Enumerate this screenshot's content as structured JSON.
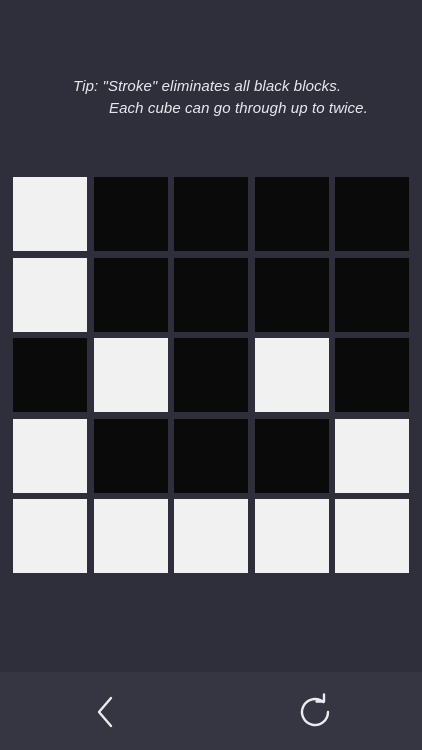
{
  "tip": {
    "line1": "Tip: \"Stroke\" eliminates all black blocks.",
    "line2": "Each cube can go through up to twice."
  },
  "board": {
    "rows": [
      [
        "white",
        "black",
        "black",
        "black",
        "black"
      ],
      [
        "white",
        "black",
        "black",
        "black",
        "black"
      ],
      [
        "black",
        "white",
        "black",
        "white",
        "black"
      ],
      [
        "white",
        "black",
        "black",
        "black",
        "white"
      ],
      [
        "white",
        "white",
        "white",
        "white",
        "white"
      ]
    ]
  },
  "nav": {
    "back_icon": "chevron-left-icon",
    "reload_icon": "reload-icon"
  },
  "colors": {
    "background": "#2e2f3a",
    "bottom_bar": "#353642",
    "white_tile": "#f1f1f1",
    "black_tile": "#0a0a0a",
    "text": "#e6e6ea"
  }
}
